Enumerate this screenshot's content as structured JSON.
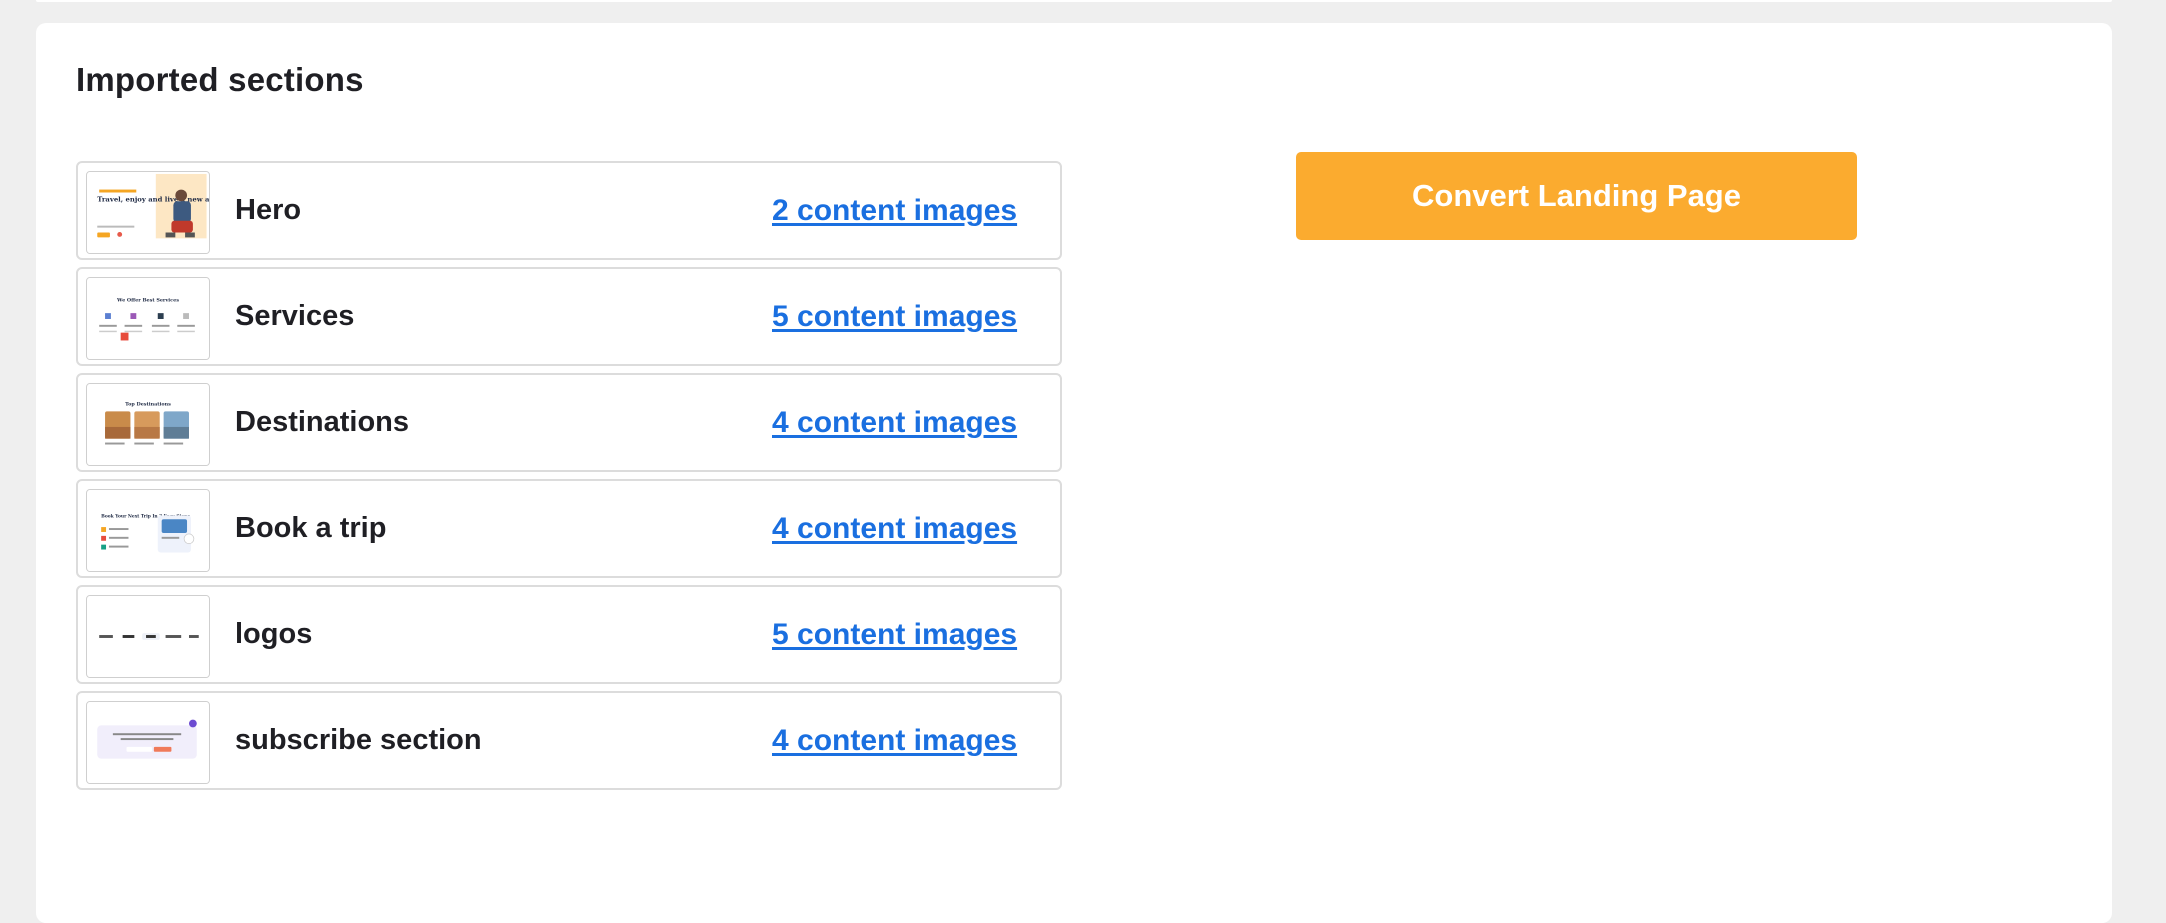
{
  "page": {
    "title": "Imported sections"
  },
  "sections": [
    {
      "name": "Hero",
      "link": "2 content images",
      "thumb_icon": "hero-thumbnail",
      "thumb_text": "Travel, enjoy and live a new and full life"
    },
    {
      "name": "Services",
      "link": "5 content images",
      "thumb_icon": "services-thumbnail",
      "thumb_text": "We Offer Best Services"
    },
    {
      "name": "Destinations",
      "link": "4 content images",
      "thumb_icon": "destinations-thumbnail",
      "thumb_text": "Top Destinations"
    },
    {
      "name": "Book a trip",
      "link": "4 content images",
      "thumb_icon": "book-trip-thumbnail",
      "thumb_text": "Book Your Next Trip In 3 Easy Steps"
    },
    {
      "name": "logos",
      "link": "5 content images",
      "thumb_icon": "logos-thumbnail",
      "thumb_text": ""
    },
    {
      "name": "subscribe section",
      "link": "4 content images",
      "thumb_icon": "subscribe-thumbnail",
      "thumb_text": ""
    }
  ],
  "actions": {
    "convert_label": "Convert Landing Page"
  },
  "colors": {
    "accent": "#fbab2f",
    "link": "#1a6fe0",
    "background": "#efefef",
    "card": "#ffffff",
    "border": "#dcdcdc"
  }
}
